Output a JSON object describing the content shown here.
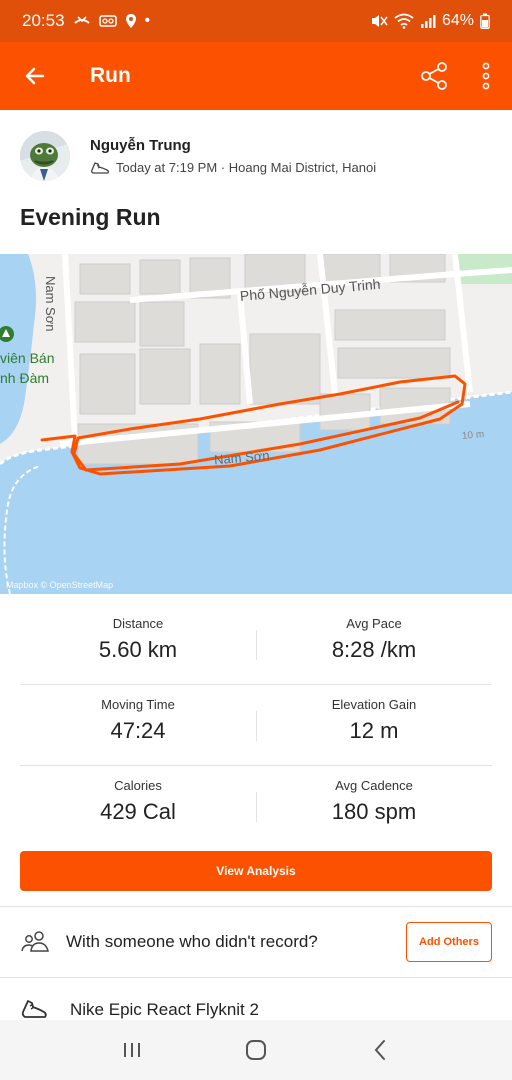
{
  "status_bar": {
    "time": "20:53",
    "battery": "64%"
  },
  "app_bar": {
    "title": "Run"
  },
  "athlete": {
    "name": "Nguyễn Trung",
    "meta": "Today at 7:19 PM · Hoang Mai District, Hanoi"
  },
  "activity": {
    "title": "Evening Run"
  },
  "map": {
    "labels": {
      "street_top": "Phố Nguyễn Duy Trinh",
      "street_left": "Nam Sơn",
      "street_bottom": "Nam Sơn",
      "place_line1": "viên Bán",
      "place_line2": "nh Đàm",
      "scale": "10 m",
      "attribution": "Mapbox © OpenStreetMap"
    },
    "colors": {
      "water": "#a9d3f2",
      "park": "#c8eac8",
      "route": "#fc5200",
      "building": "#dedcd9"
    }
  },
  "stats": [
    {
      "label": "Distance",
      "value": "5.60 km"
    },
    {
      "label": "Avg Pace",
      "value": "8:28 /km"
    },
    {
      "label": "Moving Time",
      "value": "47:24"
    },
    {
      "label": "Elevation Gain",
      "value": "12 m"
    },
    {
      "label": "Calories",
      "value": "429 Cal"
    },
    {
      "label": "Avg Cadence",
      "value": "180 spm"
    }
  ],
  "buttons": {
    "view_analysis": "View Analysis",
    "add_others": "Add Others"
  },
  "with_others": {
    "text": "With someone who didn't record?"
  },
  "gear": {
    "text": "Nike Epic React Flyknit 2"
  },
  "theme": {
    "brand": "#fc5200",
    "status_bar": "#e0500b"
  },
  "icons": {
    "back": "arrow-left-icon",
    "share": "share-icon",
    "more": "more-vertical-icon",
    "shoe": "shoe-icon",
    "people": "people-icon",
    "gear_shoe": "sneaker-icon"
  }
}
